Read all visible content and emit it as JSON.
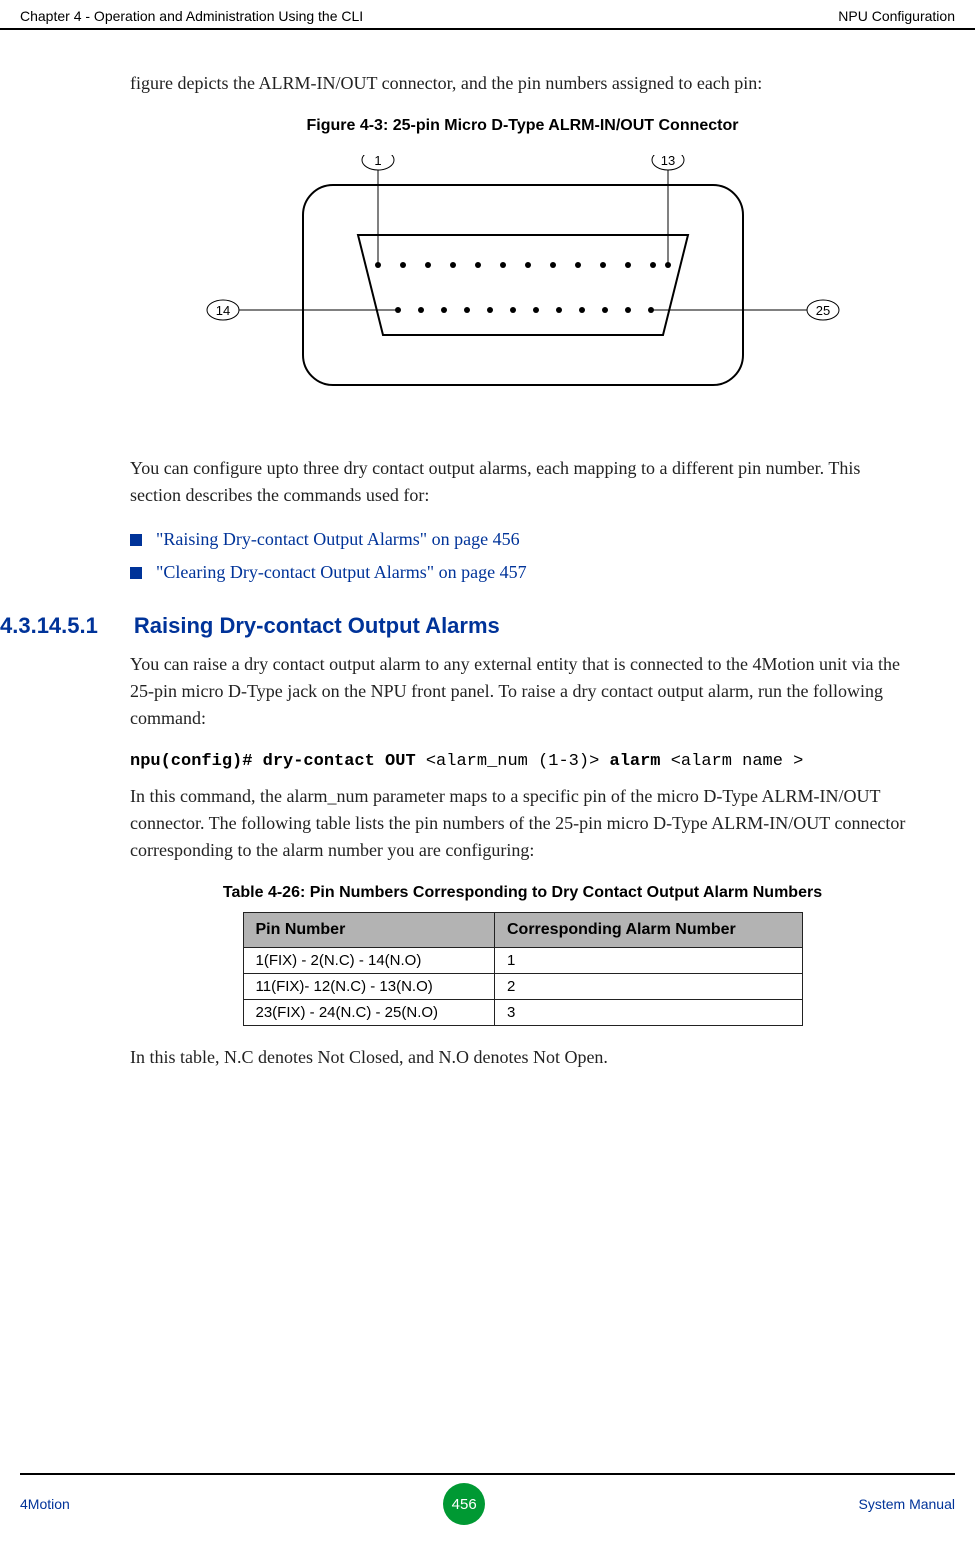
{
  "header": {
    "left": "Chapter 4 - Operation and Administration Using the CLI",
    "right": "NPU Configuration"
  },
  "content": {
    "intro_paragraph": "figure depicts the ALRM-IN/OUT connector, and the pin numbers assigned to each pin:",
    "figure_caption": "Figure 4-3: 25-pin Micro D-Type ALRM-IN/OUT Connector",
    "diagram_labels": {
      "pin1": "1",
      "pin13": "13",
      "pin14": "14",
      "pin25": "25"
    },
    "after_figure_paragraph": "You can configure upto three dry contact output alarms, each mapping to a different pin number. This section describes the commands used for:",
    "links": [
      "\"Raising Dry-contact Output Alarms\" on page 456",
      "\"Clearing Dry-contact Output Alarms\" on page 457"
    ],
    "section": {
      "number": "4.3.14.5.1",
      "title": "Raising Dry-contact Output Alarms",
      "paragraph1": "You can raise a dry contact output alarm to any external entity that is connected to the 4Motion unit via the 25-pin micro D-Type jack on the NPU front panel. To raise a dry contact output alarm, run the following command:",
      "command_bold1": "npu(config)# dry-contact OUT ",
      "command_param1": "<alarm_num (1-3)>",
      "command_bold2": " alarm ",
      "command_param2": "<alarm name >",
      "paragraph2": "In this command, the alarm_num parameter maps to a specific pin of the micro D-Type ALRM-IN/OUT connector. The following table lists the pin numbers of the 25-pin micro D-Type ALRM-IN/OUT connector corresponding to the alarm number you are configuring:",
      "table_caption": "Table 4-26: Pin Numbers Corresponding to Dry Contact Output Alarm Numbers",
      "table": {
        "headers": [
          "Pin Number",
          "Corresponding Alarm Number"
        ],
        "rows": [
          [
            "1(FIX) - 2(N.C) - 14(N.O)",
            "1"
          ],
          [
            "11(FIX)- 12(N.C) - 13(N.O)",
            "2"
          ],
          [
            "23(FIX) - 24(N.C) - 25(N.O)",
            "3"
          ]
        ]
      },
      "paragraph3": "In this table, N.C denotes Not Closed, and N.O denotes Not Open."
    }
  },
  "footer": {
    "left": "4Motion",
    "page": "456",
    "right": "System Manual"
  }
}
